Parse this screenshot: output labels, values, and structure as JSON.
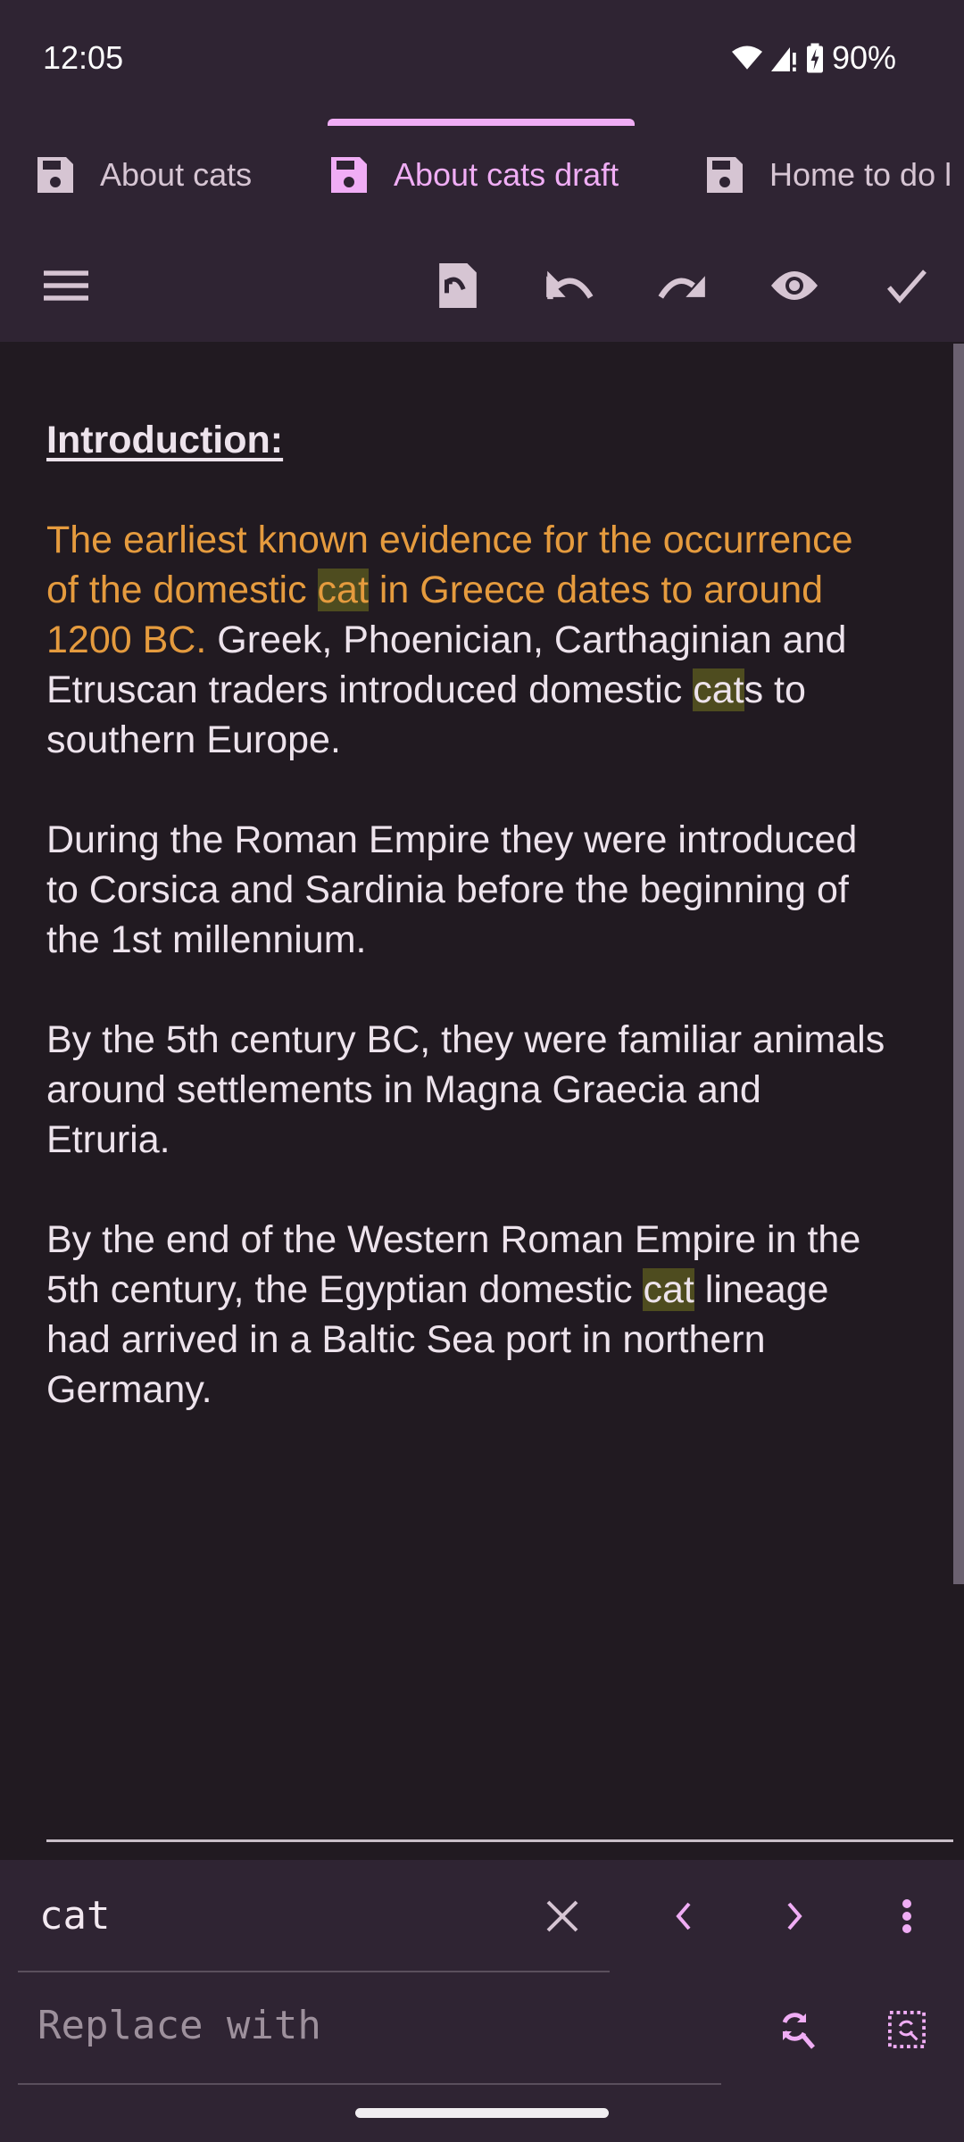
{
  "status_bar": {
    "time": "12:05",
    "battery": "90%",
    "icons": [
      "wifi-icon",
      "signal-icon",
      "battery-charging-icon"
    ]
  },
  "tabs": [
    {
      "label": "About cats",
      "icon": "floppy-disk-icon",
      "active": false
    },
    {
      "label": "About cats draft",
      "icon": "floppy-disk-icon",
      "active": true
    },
    {
      "label": "Home to do l",
      "icon": "floppy-disk-icon",
      "active": false
    }
  ],
  "toolbar": {
    "icons": [
      "menu-icon",
      "revert-file-icon",
      "undo-icon",
      "redo-icon",
      "eye-icon",
      "check-icon"
    ]
  },
  "document": {
    "lines": [
      [
        {
          "t": "Introduction:",
          "s": "heading"
        }
      ],
      [],
      [
        {
          "t": "The earliest known evidence for the occurrence",
          "s": "orange"
        }
      ],
      [
        {
          "t": "of the domestic ",
          "s": "orange"
        },
        {
          "t": "cat",
          "s": "orange hl"
        },
        {
          "t": " in Greece dates to around",
          "s": "orange"
        }
      ],
      [
        {
          "t": "1200 BC.",
          "s": "orange"
        },
        {
          "t": " Greek, Phoenician, Carthaginian and",
          "s": ""
        }
      ],
      [
        {
          "t": "Etruscan traders introduced domestic ",
          "s": ""
        },
        {
          "t": "cat",
          "s": "hl"
        },
        {
          "t": "s to",
          "s": ""
        }
      ],
      [
        {
          "t": "southern Europe.",
          "s": ""
        }
      ],
      [],
      [
        {
          "t": "During the Roman Empire they were introduced",
          "s": ""
        }
      ],
      [
        {
          "t": "to Corsica and Sardinia before the beginning of",
          "s": ""
        }
      ],
      [
        {
          "t": "the 1st millennium.",
          "s": ""
        }
      ],
      [],
      [
        {
          "t": "By the 5th century BC, they were familiar animals",
          "s": ""
        }
      ],
      [
        {
          "t": "around settlements in Magna Graecia and",
          "s": ""
        }
      ],
      [
        {
          "t": "Etruria.",
          "s": ""
        }
      ],
      [],
      [
        {
          "t": "By the end of the Western Roman Empire in the",
          "s": ""
        }
      ],
      [
        {
          "t": "5th century, the Egyptian domestic ",
          "s": ""
        },
        {
          "t": "cat",
          "s": "hl"
        },
        {
          "t": " lineage",
          "s": ""
        }
      ],
      [
        {
          "t": "had arrived in a Baltic Sea port in northern",
          "s": ""
        }
      ],
      [
        {
          "t": "Germany.",
          "s": ""
        }
      ]
    ]
  },
  "find_bar": {
    "search_value": "cat",
    "replace_placeholder": "Replace with",
    "icons": [
      "clear-icon",
      "previous-match-icon",
      "next-match-icon",
      "more-options-icon",
      "replace-icon",
      "replace-all-icon"
    ]
  },
  "colors": {
    "accent": "#f0adf5",
    "highlight": "#4e4c1f",
    "orange_text": "#e59b3e",
    "background": "#211a21",
    "bar_background": "#2f2433"
  }
}
